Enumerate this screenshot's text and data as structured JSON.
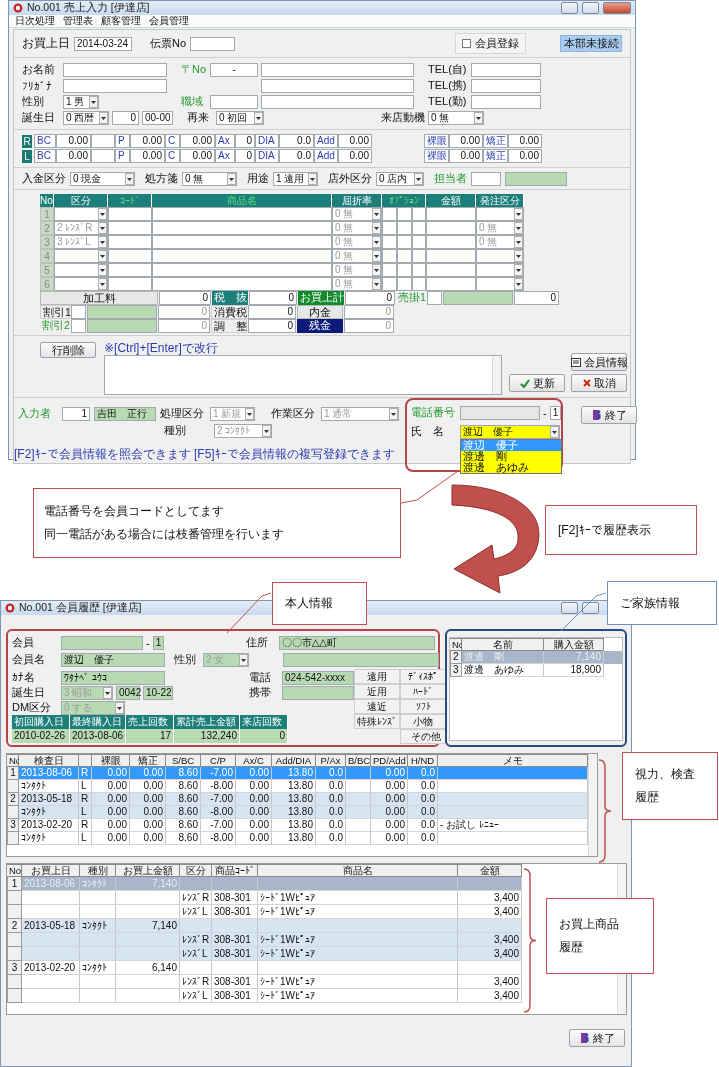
{
  "sales_window": {
    "title": "No.001 売上入力 [伊達店]",
    "menu": [
      "日次処理",
      "管理表",
      "顧客管理",
      "会員管理"
    ],
    "header": {
      "date_label": "お買上日",
      "date": "2014-03-24",
      "slip_label": "伝票No",
      "member_checkbox": {
        "label": "会員登録",
        "checked": false
      },
      "hq_status": "本部未接続"
    },
    "customer": {
      "name_label": "お名前",
      "kana_label": "ﾌﾘｶﾞﾅ",
      "sex_label": "性別",
      "sex": "1 男",
      "birth_label": "誕生日",
      "birth_era": "0 西暦",
      "birth_year": "0",
      "birth_md": "00-00",
      "zip_label": "〒No",
      "zip": "-",
      "area_label": "職域",
      "revisit_label": "再来",
      "revisit": "0 初回",
      "tel_labels": [
        "TEL(自)",
        "TEL(携)",
        "TEL(勤)"
      ],
      "motive_label": "来店動機",
      "motive": "0 無"
    },
    "lens": [
      {
        "eye": "R",
        "values": [
          {
            "label": "BC",
            "value": "0.00"
          },
          {
            "label": "P",
            "value": "0.00"
          },
          {
            "label": "C",
            "value": "0.00"
          },
          {
            "label": "Ax",
            "value": "0"
          },
          {
            "label": "DIA",
            "value": "0.0"
          },
          {
            "label": "Add",
            "value": "0.00"
          }
        ],
        "vision": [
          {
            "label": "裸眼",
            "value": "0.00"
          },
          {
            "label": "矯正",
            "value": "0.00"
          }
        ]
      },
      {
        "eye": "L",
        "values": [
          {
            "label": "BC",
            "value": "0.00"
          },
          {
            "label": "P",
            "value": "0.00"
          },
          {
            "label": "C",
            "value": "0.00"
          },
          {
            "label": "Ax",
            "value": "0"
          },
          {
            "label": "DIA",
            "value": "0.0"
          },
          {
            "label": "Add",
            "value": "0.00"
          }
        ],
        "vision": [
          {
            "label": "裸眼",
            "value": "0.00"
          },
          {
            "label": "矯正",
            "value": "0.00"
          }
        ]
      }
    ],
    "payment": {
      "fields": [
        {
          "label": "入金区分",
          "value": "0 現金"
        },
        {
          "label": "処方箋",
          "value": "0 無"
        },
        {
          "label": "用途",
          "value": "1 遠用"
        },
        {
          "label": "店外区分",
          "value": "0 店内"
        }
      ],
      "staff_label": "担当者"
    },
    "items": {
      "columns": [
        {
          "label": "No",
          "kind": "white"
        },
        {
          "label": "区分",
          "kind": "white"
        },
        {
          "label": "ｺｰﾄﾞ",
          "kind": "green"
        },
        {
          "label": "商品名",
          "kind": "green"
        },
        {
          "label": "屈折率",
          "kind": "white"
        },
        {
          "label": "ｵﾌﾟｼｮﾝ",
          "kind": "green"
        },
        {
          "label": "金額",
          "kind": "white"
        },
        {
          "label": "発注区分",
          "kind": "white"
        }
      ],
      "rows": [
        {
          "no": "1",
          "refraction": "0 無"
        },
        {
          "no": "2",
          "category": "2 ﾚﾝｽﾞR",
          "refraction": "0 無",
          "order": "0 無"
        },
        {
          "no": "3",
          "category": "3 ﾚﾝｽﾞL",
          "refraction": "0 無",
          "order": "0 無"
        },
        {
          "no": "4",
          "refraction": "0 無"
        },
        {
          "no": "5",
          "refraction": "0 無"
        },
        {
          "no": "6",
          "refraction": "0 無"
        }
      ]
    },
    "totals": [
      [
        {
          "label": "加工料",
          "kind": "button",
          "value": "0"
        },
        {
          "label": "税　抜",
          "kind": "teal",
          "value": "0"
        },
        {
          "label": "お買上計",
          "kind": "green",
          "value": "0"
        },
        {
          "label": "売掛1",
          "kind": "link",
          "value": "0"
        }
      ],
      [
        {
          "label": "割引1",
          "kind": "plain",
          "value": "0"
        },
        {
          "label": "消費税",
          "kind": "plain",
          "value": "0"
        },
        {
          "label": "内金",
          "kind": "button",
          "value": "0"
        }
      ],
      [
        {
          "label": "割引2",
          "kind": "link",
          "value": "0"
        },
        {
          "label": "調　整",
          "kind": "plain",
          "value": "0"
        },
        {
          "label": "残金",
          "kind": "navy",
          "value": "0"
        }
      ]
    ],
    "memo": {
      "delete_button": "行削除",
      "hint": "※[Ctrl]+[Enter]で改行"
    },
    "buttons": {
      "member_info": "会員情報",
      "update": "更新",
      "cancel": "取消",
      "exit": "終了"
    },
    "entry": {
      "operator_label": "入力者",
      "operator_code": "1",
      "operator_name": "吉田　正行",
      "process_label": "処理区分",
      "process": "1 新規",
      "work_label": "作業区分",
      "work": "1 通常",
      "type_label": "種別",
      "type": "2 ｺﾝﾀｸﾄ"
    },
    "phone_lookup": {
      "phone_label": "電話番号",
      "dash": "-",
      "branch": "1",
      "name_label": "氏　名",
      "name": "渡辺　優子",
      "options": [
        {
          "label": "渡辺　優子",
          "selected": true
        },
        {
          "label": "渡邊　剛",
          "selected": false
        },
        {
          "label": "渡邊　あゆみ",
          "selected": false
        }
      ]
    },
    "status": "[F2]ｷｰで会員情報を照会できます [F5]ｷｰで会員情報の複写登録できます"
  },
  "notes": {
    "phone_note": [
      "電話番号を会員コードとしてます",
      "同一電話がある場合には枝番管理を行います"
    ],
    "f2_note": "[F2]ｷｰで履歴表示",
    "personal": "本人情報",
    "family": "ご家族情報",
    "exam": [
      "視力、検査",
      "履歴"
    ],
    "purchase": [
      "お買上商品",
      "履歴"
    ]
  },
  "history_window": {
    "title": "No.001 会員履歴 [伊達店]",
    "member": {
      "member_label": "会員",
      "member_dash": "-",
      "member_branch": "1",
      "name_label": "会員名",
      "name": "渡辺　優子",
      "sex_label": "性別",
      "sex": "2 女",
      "kana_label": "ｶﾅ名",
      "kana": "ﾜﾀﾅﾍﾞ ﾕｳｺ",
      "birth_label": "誕生日",
      "birth_era": "3 昭和",
      "birth_year": "0042",
      "birth_md": "10-22",
      "dm_label": "DM区分",
      "dm": "0 する",
      "address_label": "住所",
      "address": "〇〇市△△町",
      "phone_label": "電話",
      "phone": "024-542-xxxx",
      "mobile_label": "携帯"
    },
    "categories": [
      "遠用",
      "ﾃﾞｨｽﾎﾟ",
      "近用",
      "ﾊｰﾄﾞ",
      "遠近",
      "ｿﾌﾄ",
      "特殊ﾚﾝｽﾞ",
      "小物",
      "その他"
    ],
    "stats": {
      "columns": [
        "初回購入日",
        "最終購入日",
        "売上回数",
        "累計売上金額",
        "来店回数"
      ],
      "values": [
        "2010-02-26",
        "2013-08-06",
        "17",
        "132,240",
        "0"
      ]
    },
    "family": {
      "columns": [
        "No",
        "名前",
        "購入金額"
      ],
      "rows": [
        {
          "no": "2",
          "name": "渡邊　剛",
          "amount": "7,140",
          "selected": true
        },
        {
          "no": "3",
          "name": "渡邊　あゆみ",
          "amount": "18,900",
          "selected": false
        }
      ]
    },
    "exams": {
      "columns": [
        "No",
        "検査日",
        "裸眼",
        "矯正",
        "S/BC",
        "C/P",
        "Ax/C",
        "Add/DIA",
        "P/Ax",
        "B/BC",
        "PD/Add",
        "H/ND",
        "メモ"
      ],
      "rows": [
        {
          "no": "1",
          "date": "2013-08-06",
          "eye": "R",
          "naked": "0.00",
          "corrected": "0.00",
          "s_bc": "8.60",
          "c_p": "-7.00",
          "ax_c": "0.00",
          "add_dia": "13.80",
          "p_ax": "0.0",
          "pd_add": "0.00",
          "h_nd": "0.0",
          "selected": true,
          "banded": false
        },
        {
          "date": "ｺﾝﾀｸﾄ",
          "eye": "L",
          "naked": "0.00",
          "corrected": "0.00",
          "s_bc": "8.60",
          "c_p": "-8.00",
          "ax_c": "0.00",
          "add_dia": "13.80",
          "p_ax": "0.0",
          "pd_add": "0.00",
          "h_nd": "0.0",
          "selected": false,
          "banded": false
        },
        {
          "no": "2",
          "date": "2013-05-18",
          "eye": "R",
          "naked": "0.00",
          "corrected": "0.00",
          "s_bc": "8.60",
          "c_p": "-7.00",
          "ax_c": "0.00",
          "add_dia": "13.80",
          "p_ax": "0.0",
          "pd_add": "0.00",
          "h_nd": "0.0",
          "selected": false,
          "banded": true
        },
        {
          "date": "ｺﾝﾀｸﾄ",
          "eye": "L",
          "naked": "0.00",
          "corrected": "0.00",
          "s_bc": "8.60",
          "c_p": "-8.00",
          "ax_c": "0.00",
          "add_dia": "13.80",
          "p_ax": "0.0",
          "pd_add": "0.00",
          "h_nd": "0.0",
          "selected": false,
          "banded": true
        },
        {
          "no": "3",
          "date": "2013-02-20",
          "eye": "R",
          "naked": "0.00",
          "corrected": "0.00",
          "s_bc": "8.60",
          "c_p": "-7.00",
          "ax_c": "0.00",
          "add_dia": "13.80",
          "p_ax": "0.0",
          "pd_add": "0.00",
          "h_nd": "0.0",
          "memo": "- お試し ﾚﾆｭｰ",
          "selected": false,
          "banded": false
        },
        {
          "date": "ｺﾝﾀｸﾄ",
          "eye": "L",
          "naked": "0.00",
          "corrected": "0.00",
          "s_bc": "8.60",
          "c_p": "-8.00",
          "ax_c": "0.00",
          "add_dia": "13.80",
          "p_ax": "0.0",
          "pd_add": "0.00",
          "h_nd": "0.0",
          "selected": false,
          "banded": false
        }
      ]
    },
    "purchases": {
      "columns": [
        "No",
        "お買上日",
        "種別",
        "お買上金額",
        "区分",
        "商品ｺｰﾄﾞ",
        "商品名",
        "金額"
      ],
      "rows": [
        {
          "no": "1",
          "date": "2013-08-06",
          "type": "ｺﾝﾀｸﾄ",
          "total": "7,140",
          "selected": true,
          "banded": false
        },
        {
          "category": "ﾚﾝｽﾞR",
          "code": "308-301",
          "product": "ｼｰﾄﾞ1Wﾋﾟｭｱ",
          "amount": "3,400",
          "selected": false,
          "banded": false
        },
        {
          "category": "ﾚﾝｽﾞL",
          "code": "308-301",
          "product": "ｼｰﾄﾞ1Wﾋﾟｭｱ",
          "amount": "3,400",
          "selected": false,
          "banded": false
        },
        {
          "no": "2",
          "date": "2013-05-18",
          "type": "ｺﾝﾀｸﾄ",
          "total": "7,140",
          "selected": false,
          "banded": true
        },
        {
          "category": "ﾚﾝｽﾞR",
          "code": "308-301",
          "product": "ｼｰﾄﾞ1Wﾋﾟｭｱ",
          "amount": "3,400",
          "selected": false,
          "banded": true
        },
        {
          "category": "ﾚﾝｽﾞL",
          "code": "308-301",
          "product": "ｼｰﾄﾞ1Wﾋﾟｭｱ",
          "amount": "3,400",
          "selected": false,
          "banded": true
        },
        {
          "no": "3",
          "date": "2013-02-20",
          "type": "ｺﾝﾀｸﾄ",
          "total": "6,140",
          "selected": false,
          "banded": false
        },
        {
          "category": "ﾚﾝｽﾞR",
          "code": "308-301",
          "product": "ｼｰﾄﾞ1Wﾋﾟｭｱ",
          "amount": "3,400",
          "selected": false,
          "banded": false
        },
        {
          "category": "ﾚﾝｽﾞL",
          "code": "308-301",
          "product": "ｼｰﾄﾞ1Wﾋﾟｭｱ",
          "amount": "3,400",
          "selected": false,
          "banded": false
        }
      ]
    },
    "exit": "終了"
  }
}
